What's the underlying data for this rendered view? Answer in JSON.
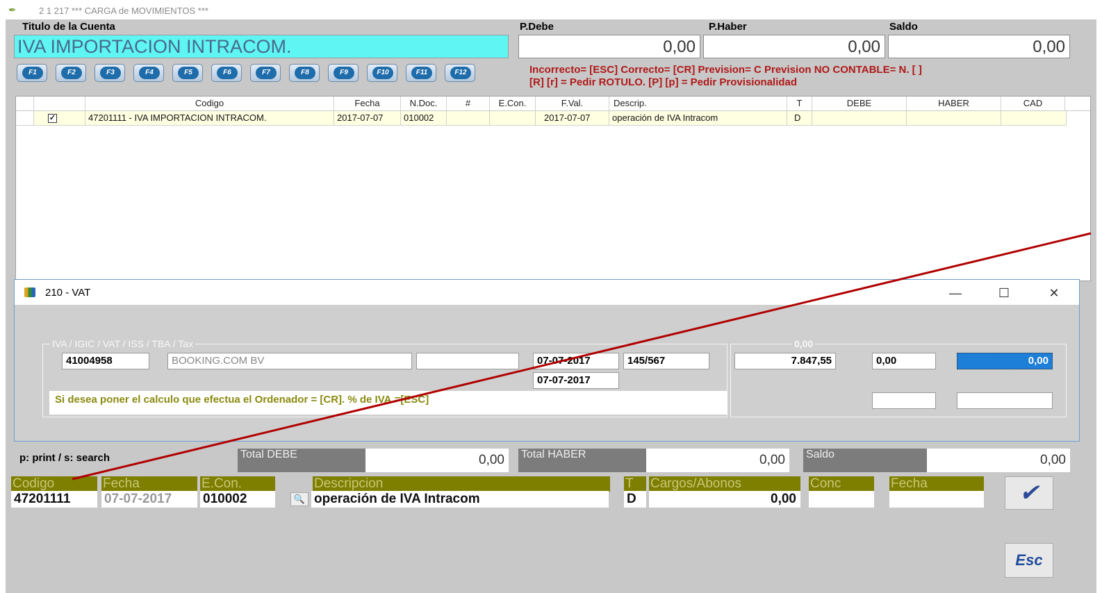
{
  "window": {
    "title": "2 1 217 *** CARGA  de  MOVIMIENTOS ***",
    "icon": "pen-icon"
  },
  "header": {
    "title_label": "Titulo de la Cuenta",
    "debe_label": "P.Debe",
    "haber_label": "P.Haber",
    "saldo_label": "Saldo",
    "account_title": "IVA IMPORTACION INTRACOM.",
    "debe_value": "0,00",
    "haber_value": "0,00",
    "saldo_value": "0,00"
  },
  "fkeys": [
    "F1",
    "F2",
    "F3",
    "F4",
    "F5",
    "F6",
    "F7",
    "F8",
    "F9",
    "F10",
    "F11",
    "F12"
  ],
  "help": {
    "line1": "Incorrecto= [ESC] Correcto= [CR] Prevision= C Prevision NO CONTABLE= N.  [ ]",
    "line2": "[R] [r] = Pedir ROTULO.  [P] [p] = Pedir Provisionalidad"
  },
  "grid": {
    "columns": [
      "Codigo",
      "Fecha",
      "N.Doc.",
      "#",
      "E.Con.",
      "F.Val.",
      "Descrip.",
      "T",
      "DEBE",
      "HABER",
      "CAD"
    ],
    "rows": [
      {
        "checked": "✓",
        "codigo": "47201111 - IVA IMPORTACION INTRACOM.",
        "fecha": "2017-07-07",
        "ndoc": "010002",
        "num": "",
        "econ": "",
        "fval": "2017-07-07",
        "descrip": "operación de IVA Intracom",
        "t": "D",
        "debe": "",
        "haber": "",
        "cad": ""
      }
    ]
  },
  "dialog": {
    "title": "210 - VAT",
    "group_label": "IVA / IGIC / VAT / ISS / TBA / Tax",
    "group2_label": "0,00",
    "account": "41004958",
    "name": "BOOKING.COM BV",
    "extra": "",
    "date1": "07-07-2017",
    "doc": "145/567",
    "date2": "07-07-2017",
    "base": "7.847,55",
    "pct": "0,00",
    "amount": "0,00",
    "message": "Si desea poner el calculo que efectua el Ordenador = [CR].  % de IVA.=[ESC]"
  },
  "footer": {
    "hint": "p: print / s: search",
    "total_debe_label": "Total DEBE",
    "total_debe": "0,00",
    "total_haber_label": "Total HABER",
    "total_haber": "0,00",
    "saldo_label": "Saldo",
    "saldo": "0,00"
  },
  "entry": {
    "codigo_label": "Codigo",
    "fecha_label": "Fecha",
    "econ_label": "E.Con.",
    "descripcion_label": "Descripcion",
    "t_label": "T",
    "cargos_label": "Cargos/Abonos",
    "conc_label": "Conc",
    "fecha2_label": "Fecha",
    "codigo": "47201111",
    "fecha": "07-07-2017",
    "econ": "010002",
    "descripcion": "operación de IVA Intracom",
    "t": "D",
    "cargos": "0,00",
    "conc": "",
    "fecha2": ""
  },
  "buttons": {
    "ok": "✔",
    "esc": "Esc"
  },
  "colors": {
    "annotation_line": "#b00000",
    "title_bg": "#5ef5f3",
    "help_text": "#b01818"
  }
}
